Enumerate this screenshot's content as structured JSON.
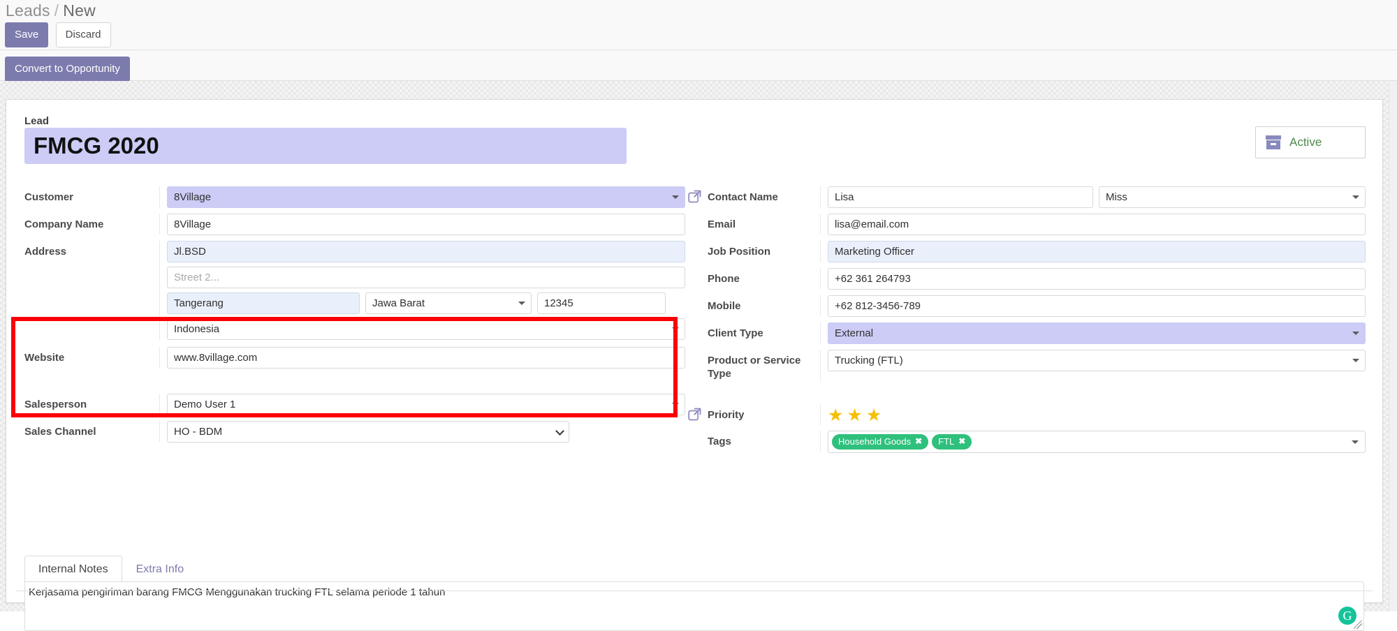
{
  "breadcrumb": {
    "root": "Leads",
    "separator": "/",
    "current": "New"
  },
  "control_panel": {
    "save_label": "Save",
    "discard_label": "Discard",
    "convert_label": "Convert to Opportunity"
  },
  "record": {
    "lead_label": "Lead",
    "lead_title": "FMCG 2020",
    "active_label": "Active",
    "active_icon": "archive-box-icon"
  },
  "left_column": [
    {
      "label": "Customer",
      "name": "customer",
      "value": "8Village",
      "widget": "many2one",
      "state": "selected"
    },
    {
      "label": "Company Name",
      "name": "company-name",
      "value": "8Village",
      "widget": "char",
      "state": "normal"
    },
    {
      "label": "Website",
      "name": "website",
      "value": "www.8village.com",
      "widget": "char",
      "state": "normal"
    },
    {
      "label": "Salesperson",
      "name": "salesperson",
      "value": "Demo User 1",
      "widget": "many2one",
      "state": "normal"
    },
    {
      "label": "Sales Channel",
      "name": "sales-channel",
      "value": "HO - BDM",
      "widget": "select",
      "state": "normal"
    }
  ],
  "address": {
    "label": "Address",
    "street": "Jl.BSD",
    "street_placeholder": "Street...",
    "street2": "",
    "street2_placeholder": "Street 2...",
    "city": "Tangerang",
    "city_placeholder": "City",
    "state": "Jawa Barat",
    "zip": "12345",
    "zip_placeholder": "ZIP",
    "country": "Indonesia"
  },
  "right_column": {
    "contact_name": {
      "label": "Contact Name",
      "value": "Lisa",
      "title": "Miss",
      "icon": "external-link-icon"
    },
    "email": {
      "label": "Email",
      "value": "lisa@email.com"
    },
    "job_position": {
      "label": "Job Position",
      "value": "Marketing Officer"
    },
    "phone": {
      "label": "Phone",
      "value": "+62 361 264793"
    },
    "mobile": {
      "label": "Mobile",
      "value": "+62 812-3456-789"
    },
    "client_type": {
      "label": "Client Type",
      "value": "External"
    },
    "product_type": {
      "label": "Product or Service Type",
      "value": "Trucking (FTL)"
    },
    "priority": {
      "label": "Priority",
      "stars_filled": 3,
      "icon": "external-link-icon"
    },
    "tags": {
      "label": "Tags",
      "values": [
        "Household Goods",
        "FTL"
      ],
      "remove_glyph": "✖"
    }
  },
  "notebook": {
    "tabs": [
      {
        "label": "Internal Notes",
        "active": true
      },
      {
        "label": "Extra Info",
        "active": false
      }
    ],
    "notes": "Kerjasama pengiriman barang FMCG Menggunakan trucking FTL selama periode 1 tahun",
    "grammarly_glyph": "G"
  },
  "colors": {
    "brand_purple": "#7c7bad",
    "selected_field": "#ccccf7",
    "focused_field": "#eaf0fb",
    "tag_green": "#2ec07c",
    "star_yellow": "#f6c000",
    "annotation_red": "#fb0007",
    "active_text_green": "#4c8a4c",
    "grammarly_green": "#15c39a"
  }
}
